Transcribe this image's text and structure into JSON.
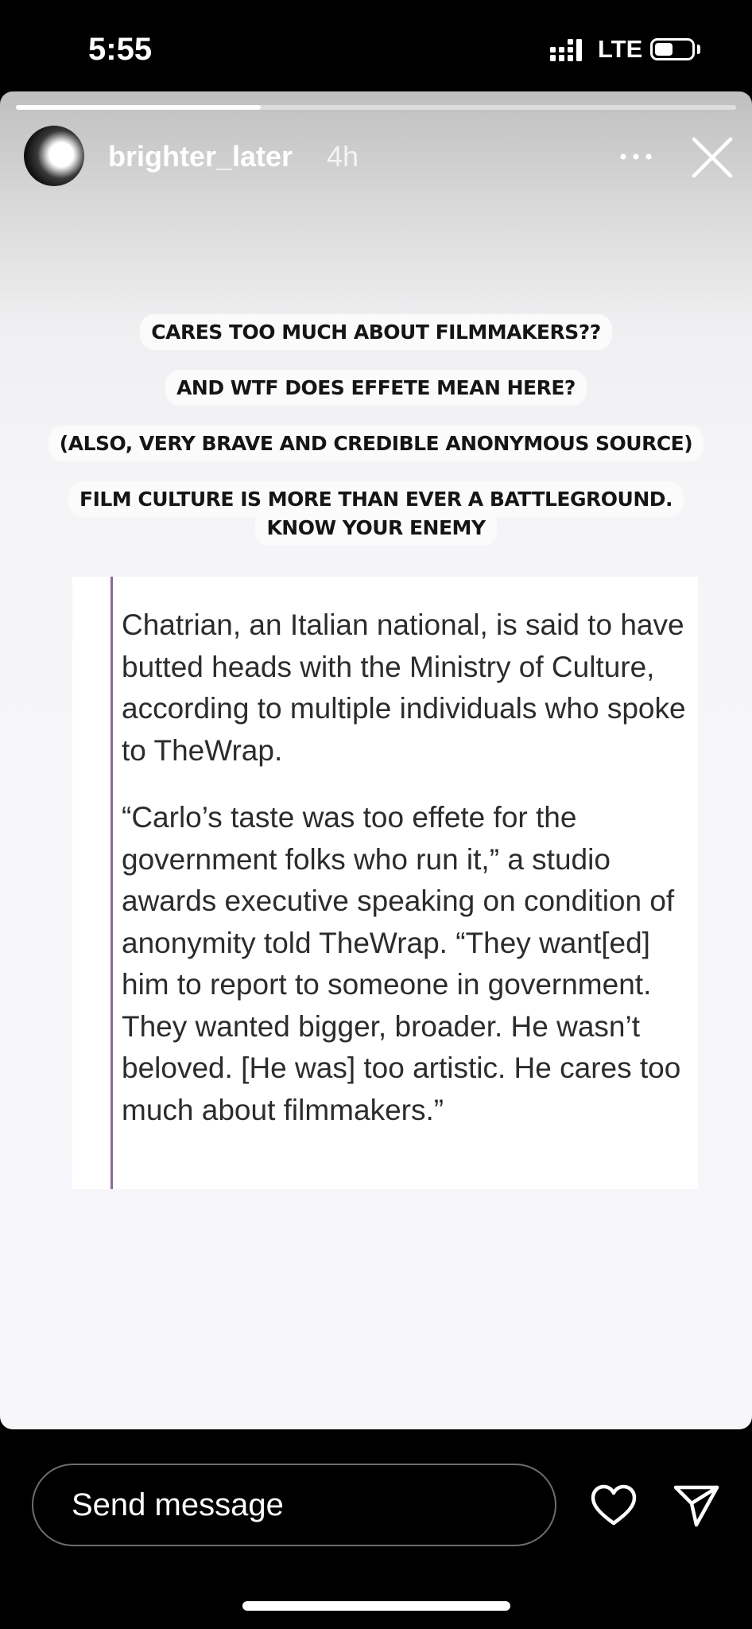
{
  "status_bar": {
    "time": "5:55",
    "network": "LTE"
  },
  "story": {
    "progress": 0.34,
    "username": "brighter_later",
    "time_ago": "4h",
    "captions": [
      "CARES TOO MUCH ABOUT FILMMAKERS??",
      "AND WTF DOES EFFETE MEAN HERE?",
      "(ALSO, VERY BRAVE AND CREDIBLE ANONYMOUS SOURCE)",
      "FILM CULTURE IS MORE THAN EVER A BATTLEGROUND.",
      "KNOW YOUR ENEMY"
    ],
    "quote_paragraphs": [
      "Chatrian, an Italian national, is said to have butted heads with the Ministry of Culture, according to multiple individuals who spoke to TheWrap.",
      "“Carlo’s taste was too effete for the government folks who run it,” a studio awards executive speaking on condition of anonymity told TheWrap. “They want[ed] him to report to someone in government. They wanted bigger, broader. He wasn’t beloved. [He was] too artistic. He cares too much about filmmakers.”"
    ]
  },
  "reply_bar": {
    "placeholder": "Send message"
  },
  "icons": {
    "signal": "signal-icon",
    "battery": "battery-icon",
    "more": "more-dots-icon",
    "close": "close-icon",
    "like": "heart-icon",
    "share": "send-icon"
  },
  "colors": {
    "quote_bar": "#8c6a9a",
    "background": "#000000"
  }
}
